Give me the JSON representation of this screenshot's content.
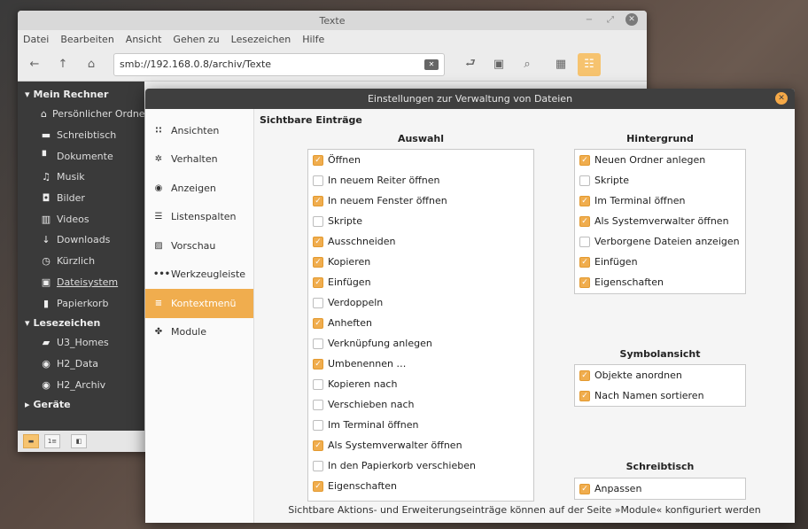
{
  "nemo": {
    "title": "Texte",
    "menu": [
      "Datei",
      "Bearbeiten",
      "Ansicht",
      "Gehen zu",
      "Lesezeichen",
      "Hilfe"
    ],
    "path": "smb://192.168.0.8/archiv/Texte",
    "sidebar": {
      "section_computer": "Mein Rechner",
      "computer_items": [
        {
          "label": "Persönlicher Ordner",
          "icon": "home-icon"
        },
        {
          "label": "Schreibtisch",
          "icon": "desktop-icon"
        },
        {
          "label": "Dokumente",
          "icon": "document-icon"
        },
        {
          "label": "Musik",
          "icon": "music-icon"
        },
        {
          "label": "Bilder",
          "icon": "camera-icon"
        },
        {
          "label": "Videos",
          "icon": "film-icon"
        },
        {
          "label": "Downloads",
          "icon": "download-icon"
        },
        {
          "label": "Kürzlich",
          "icon": "clock-icon"
        },
        {
          "label": "Dateisystem",
          "icon": "drive-icon"
        },
        {
          "label": "Papierkorb",
          "icon": "trash-icon"
        }
      ],
      "section_bookmarks": "Lesezeichen",
      "bookmark_items": [
        {
          "label": "U3_Homes",
          "icon": "network-folder-icon"
        },
        {
          "label": "H2_Data",
          "icon": "globe-icon"
        },
        {
          "label": "H2_Archiv",
          "icon": "globe-icon"
        }
      ],
      "section_devices": "Geräte"
    }
  },
  "dialog": {
    "title": "Einstellungen zur Verwaltung von Dateien",
    "nav": [
      {
        "label": "Ansichten",
        "icon": "grid-icon",
        "active": false
      },
      {
        "label": "Verhalten",
        "icon": "gear-icon",
        "active": false
      },
      {
        "label": "Anzeigen",
        "icon": "eye-icon",
        "active": false
      },
      {
        "label": "Listenspalten",
        "icon": "list-icon",
        "active": false
      },
      {
        "label": "Vorschau",
        "icon": "image-icon",
        "active": false
      },
      {
        "label": "Werkzeugleiste",
        "icon": "dots-icon",
        "active": false
      },
      {
        "label": "Kontextmenü",
        "icon": "menu-icon",
        "active": true
      },
      {
        "label": "Module",
        "icon": "puzzle-icon",
        "active": false
      }
    ],
    "heading": "Sichtbare Einträge",
    "auswahl": {
      "title": "Auswahl",
      "items": [
        {
          "label": "Öffnen",
          "checked": true
        },
        {
          "label": "In neuem Reiter öffnen",
          "checked": false
        },
        {
          "label": "In neuem Fenster öffnen",
          "checked": true
        },
        {
          "label": "Skripte",
          "checked": false
        },
        {
          "label": "Ausschneiden",
          "checked": true
        },
        {
          "label": "Kopieren",
          "checked": true
        },
        {
          "label": "Einfügen",
          "checked": true
        },
        {
          "label": "Verdoppeln",
          "checked": false
        },
        {
          "label": "Anheften",
          "checked": true
        },
        {
          "label": "Verknüpfung anlegen",
          "checked": false
        },
        {
          "label": "Umbenennen …",
          "checked": true
        },
        {
          "label": "Kopieren nach",
          "checked": false
        },
        {
          "label": "Verschieben nach",
          "checked": false
        },
        {
          "label": "Im Terminal öffnen",
          "checked": false
        },
        {
          "label": "Als Systemverwalter öffnen",
          "checked": true
        },
        {
          "label": "In den Papierkorb verschieben",
          "checked": false
        },
        {
          "label": "Eigenschaften",
          "checked": true
        }
      ]
    },
    "hintergrund": {
      "title": "Hintergrund",
      "items": [
        {
          "label": "Neuen Ordner anlegen",
          "checked": true
        },
        {
          "label": "Skripte",
          "checked": false
        },
        {
          "label": "Im Terminal öffnen",
          "checked": true
        },
        {
          "label": "Als Systemverwalter öffnen",
          "checked": true
        },
        {
          "label": "Verborgene Dateien anzeigen",
          "checked": false
        },
        {
          "label": "Einfügen",
          "checked": true
        },
        {
          "label": "Eigenschaften",
          "checked": true
        }
      ]
    },
    "symbolansicht": {
      "title": "Symbolansicht",
      "items": [
        {
          "label": "Objekte anordnen",
          "checked": true
        },
        {
          "label": "Nach Namen sortieren",
          "checked": true
        }
      ]
    },
    "schreibtisch": {
      "title": "Schreibtisch",
      "items": [
        {
          "label": "Anpassen",
          "checked": true
        }
      ]
    },
    "footer": "Sichtbare Aktions- und Erweiterungseinträge können auf der Seite »Module« konfiguriert werden"
  },
  "colors": {
    "accent": "#f0ad4e",
    "sidebar_bg": "#3a3a3a",
    "dialog_title_bg": "#3f3f3f"
  }
}
